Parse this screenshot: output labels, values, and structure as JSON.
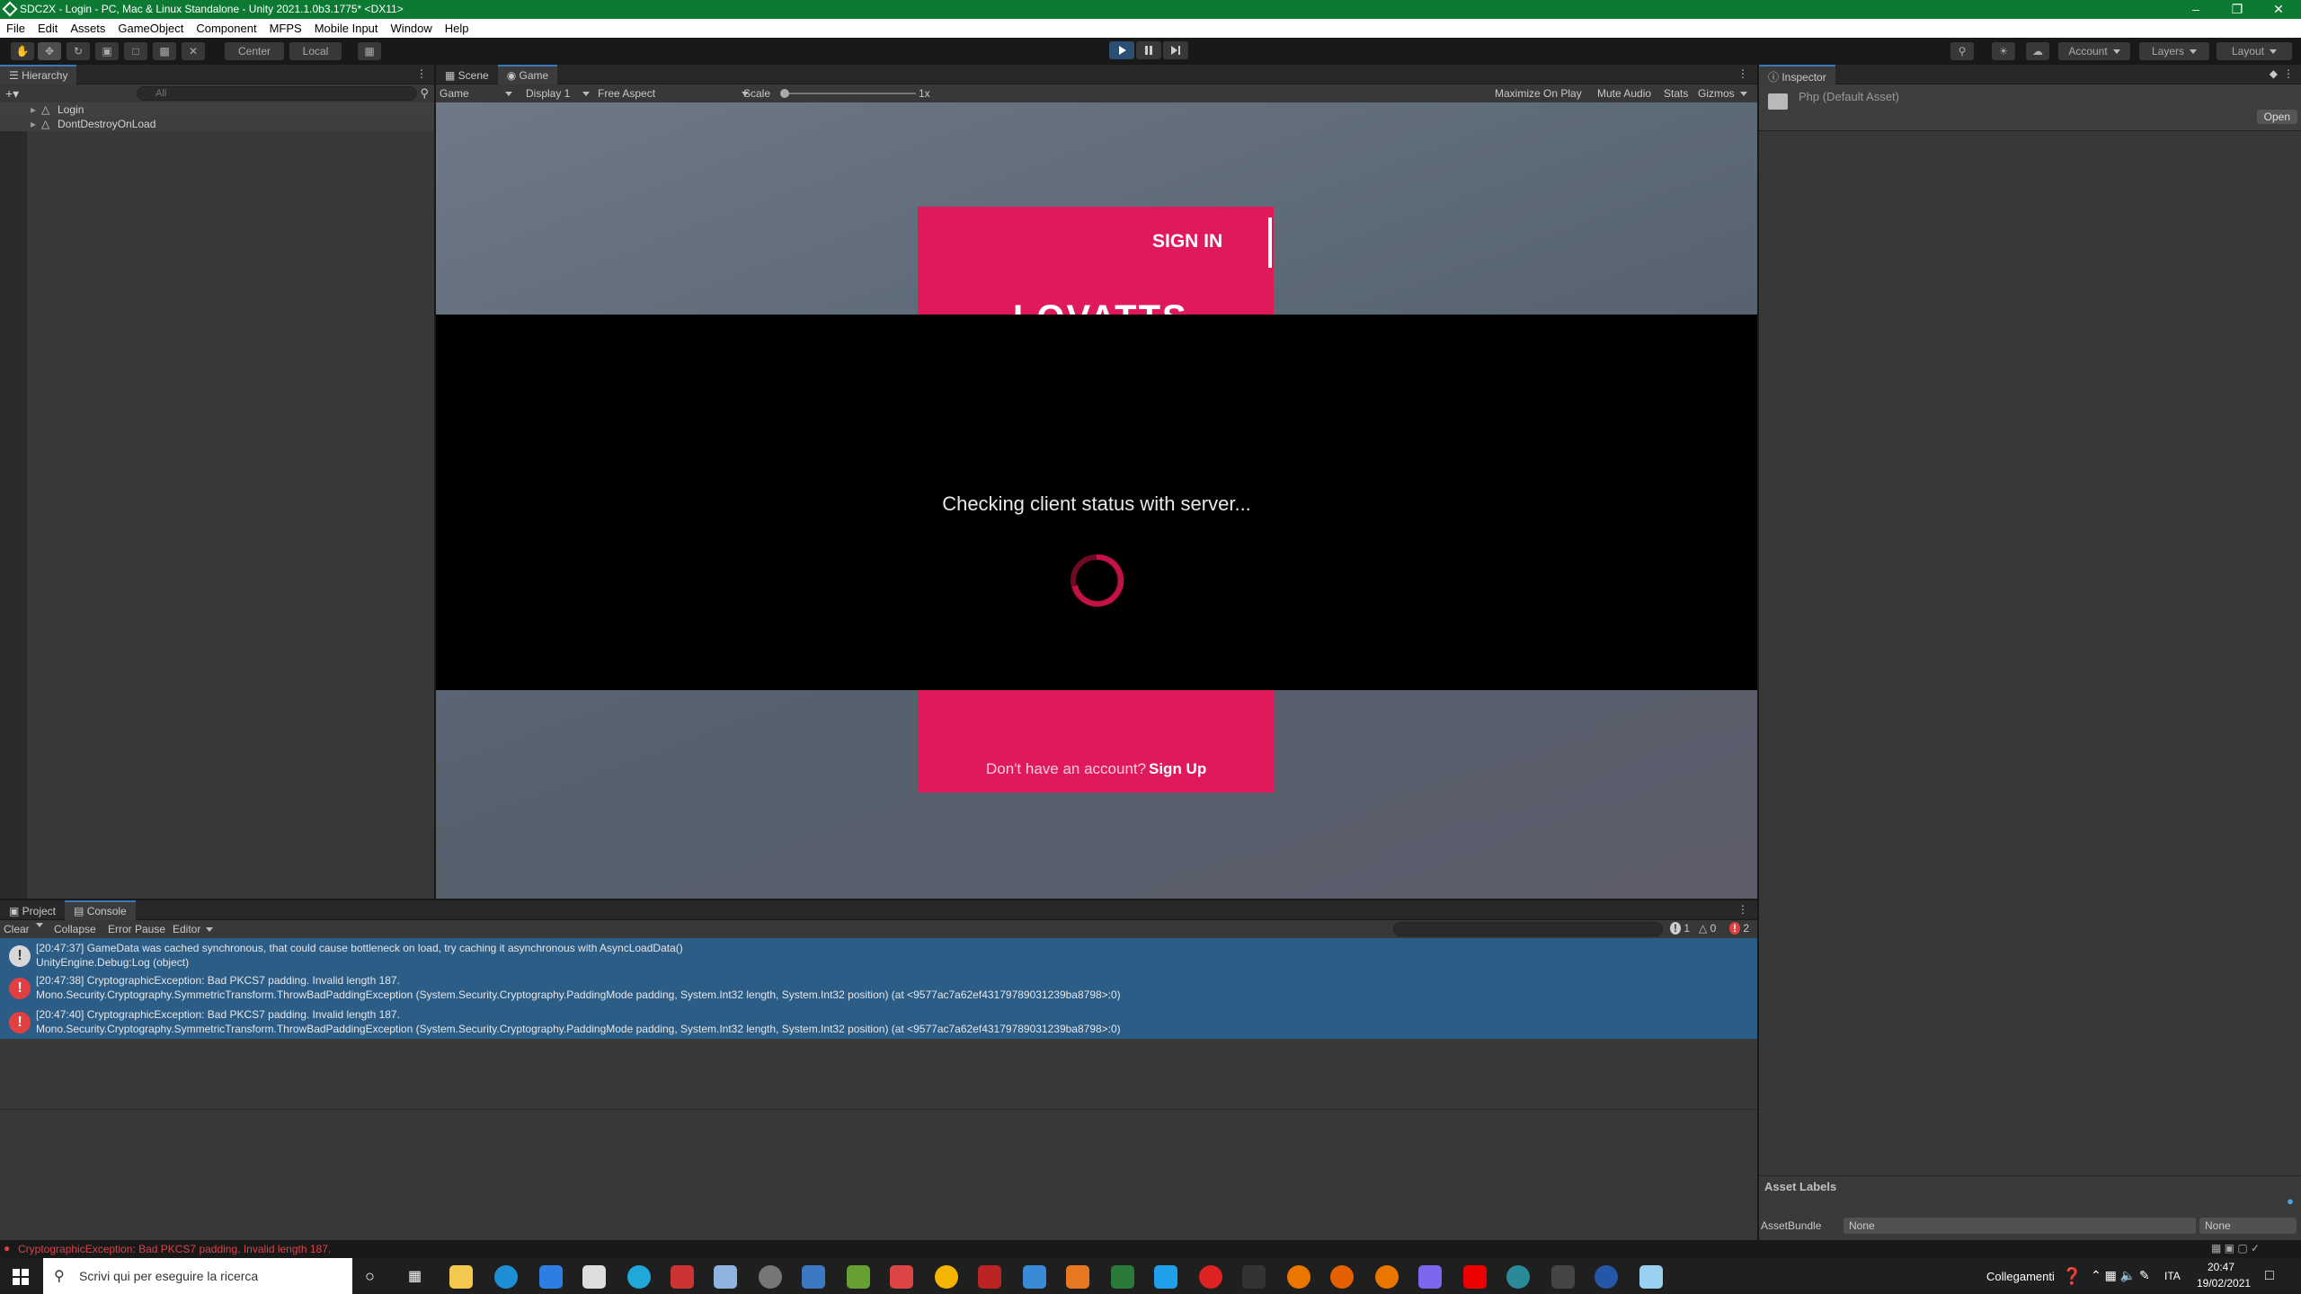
{
  "window": {
    "title": "SDC2X - Login - PC, Mac & Linux Standalone - Unity 2021.1.0b3.1775* <DX11>"
  },
  "menu": [
    "File",
    "Edit",
    "Assets",
    "GameObject",
    "Component",
    "MFPS",
    "Mobile Input",
    "Window",
    "Help"
  ],
  "toolbar": {
    "center_label": "Center",
    "local_label": "Local",
    "account_label": "Account",
    "layers_label": "Layers",
    "layout_label": "Layout"
  },
  "hierarchy": {
    "tab": "Hierarchy",
    "search_placeholder": "All",
    "items": [
      "Login",
      "DontDestroyOnLoad"
    ]
  },
  "game": {
    "tabs": [
      "Scene",
      "Game"
    ],
    "display_mode": "Game",
    "display": "Display 1",
    "aspect": "Free Aspect",
    "scale_label": "Scale",
    "scale_value": "1x",
    "maximize": "Maximize On Play",
    "mute": "Mute Audio",
    "stats": "Stats",
    "gizmos": "Gizmos"
  },
  "login": {
    "sign_in": "SIGN IN",
    "partial_title": "LOVATTS",
    "status_text": "Checking client status with server...",
    "no_account": "Don't have an account?",
    "sign_up": "Sign Up"
  },
  "inspector": {
    "tab": "Inspector",
    "asset_name": "Php (Default Asset)",
    "open_button": "Open",
    "asset_labels": "Asset Labels",
    "asset_bundle_label": "AssetBundle",
    "bundle_value": "None",
    "variant_value": "None"
  },
  "console": {
    "tabs": [
      "Project",
      "Console"
    ],
    "clear": "Clear",
    "collapse": "Collapse",
    "error_pause": "Error Pause",
    "editor": "Editor",
    "count_info": "1",
    "count_warn": "0",
    "count_error": "2",
    "rows": [
      {
        "line1": "[20:47:37] GameData was cached synchronous, that could cause bottleneck on load, try caching it asynchronous with AsyncLoadData()",
        "line2": "UnityEngine.Debug:Log (object)"
      },
      {
        "line1": "[20:47:38] CryptographicException: Bad PKCS7 padding. Invalid length 187.",
        "line2": "Mono.Security.Cryptography.SymmetricTransform.ThrowBadPaddingException (System.Security.Cryptography.PaddingMode padding, System.Int32 length, System.Int32 position) (at <9577ac7a62ef43179789031239ba8798>:0)"
      },
      {
        "line1": "[20:47:40] CryptographicException: Bad PKCS7 padding. Invalid length 187.",
        "line2": "Mono.Security.Cryptography.SymmetricTransform.ThrowBadPaddingException (System.Security.Cryptography.PaddingMode padding, System.Int32 length, System.Int32 position) (at <9577ac7a62ef43179789031239ba8798>:0)"
      }
    ]
  },
  "statusbar": {
    "text": "CryptographicException: Bad PKCS7 padding. Invalid length 187."
  },
  "taskbar": {
    "search_placeholder": "Scrivi qui per eseguire la ricerca",
    "links_label": "Collegamenti",
    "language": "ITA",
    "time": "20:47",
    "date": "19/02/2021"
  },
  "colors": {
    "accent_pink": "#e0195a",
    "title_green": "#0d7a33",
    "selection_blue": "#2c5d87"
  }
}
